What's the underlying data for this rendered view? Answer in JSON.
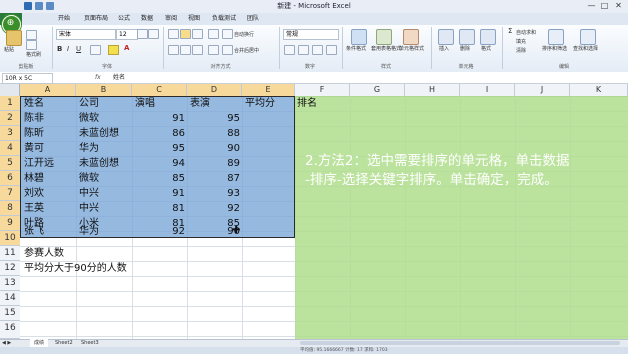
{
  "window": {
    "title": "新建 - Microsoft Excel",
    "controls": [
      "—",
      "□",
      "✕"
    ]
  },
  "ribbon": {
    "file_tab": "文件",
    "tabs": [
      "开始",
      "页面布局",
      "公式",
      "数据",
      "审阅",
      "视图",
      "负载测试",
      "团队"
    ],
    "clipboard": {
      "paste": "粘贴",
      "format_painter": "格式刷",
      "group": "剪贴板"
    },
    "font": {
      "name": "宋体",
      "size": "12",
      "group": "字体"
    },
    "alignment": {
      "wrap": "自动换行",
      "merge": "合并后居中",
      "group": "对齐方式"
    },
    "number": {
      "format": "常规",
      "group": "数字"
    },
    "styles": {
      "conditional": "条件格式",
      "table": "套用表格格式",
      "cell_styles": "单元格样式",
      "group": "样式"
    },
    "cells": {
      "insert": "插入",
      "delete": "删除",
      "format": "格式",
      "group": "单元格"
    },
    "editing": {
      "autosum": "自动求和",
      "fill": "填充",
      "clear": "清除",
      "sort": "排序和筛选",
      "find": "查找和选择",
      "group": "编辑"
    }
  },
  "formula_bar": {
    "name_box": "10R x 5C",
    "fx": "fx",
    "content": "姓名"
  },
  "columns": [
    "A",
    "B",
    "C",
    "D",
    "E",
    "F",
    "G",
    "H",
    "I",
    "J",
    "K"
  ],
  "rows": [
    "1",
    "2",
    "3",
    "4",
    "5",
    "6",
    "7",
    "8",
    "9",
    "10",
    "11",
    "12",
    "13",
    "14",
    "15",
    "16"
  ],
  "table": {
    "headers": [
      "姓名",
      "公司",
      "演唱",
      "表演",
      "平均分"
    ],
    "f1": "排名",
    "records": [
      [
        "陈非",
        "微软",
        "91",
        "95"
      ],
      [
        "陈昕",
        "未蓝创想",
        "86",
        "88"
      ],
      [
        "黄可",
        "华为",
        "95",
        "90"
      ],
      [
        "江开远",
        "未蓝创想",
        "94",
        "89"
      ],
      [
        "林碧",
        "微软",
        "85",
        "87"
      ],
      [
        "刘欢",
        "中兴",
        "91",
        "93"
      ],
      [
        "王英",
        "中兴",
        "81",
        "92"
      ],
      [
        "叶路",
        "小米",
        "81",
        "85"
      ],
      [
        "张飞",
        "华为",
        "92",
        "90"
      ]
    ],
    "a12": "参赛人数",
    "a13": "平均分大于90分的人数"
  },
  "note": {
    "line1": "2.方法2：选中需要排序的单元格，单击数据",
    "line2": "-排序-选择关键字排序。单击确定，完成。"
  },
  "sheets": [
    "成绩",
    "Sheet2",
    "Sheet3"
  ],
  "status": {
    "summary": "平均值: 95.1666667    计数: 17    求和: 1703"
  }
}
